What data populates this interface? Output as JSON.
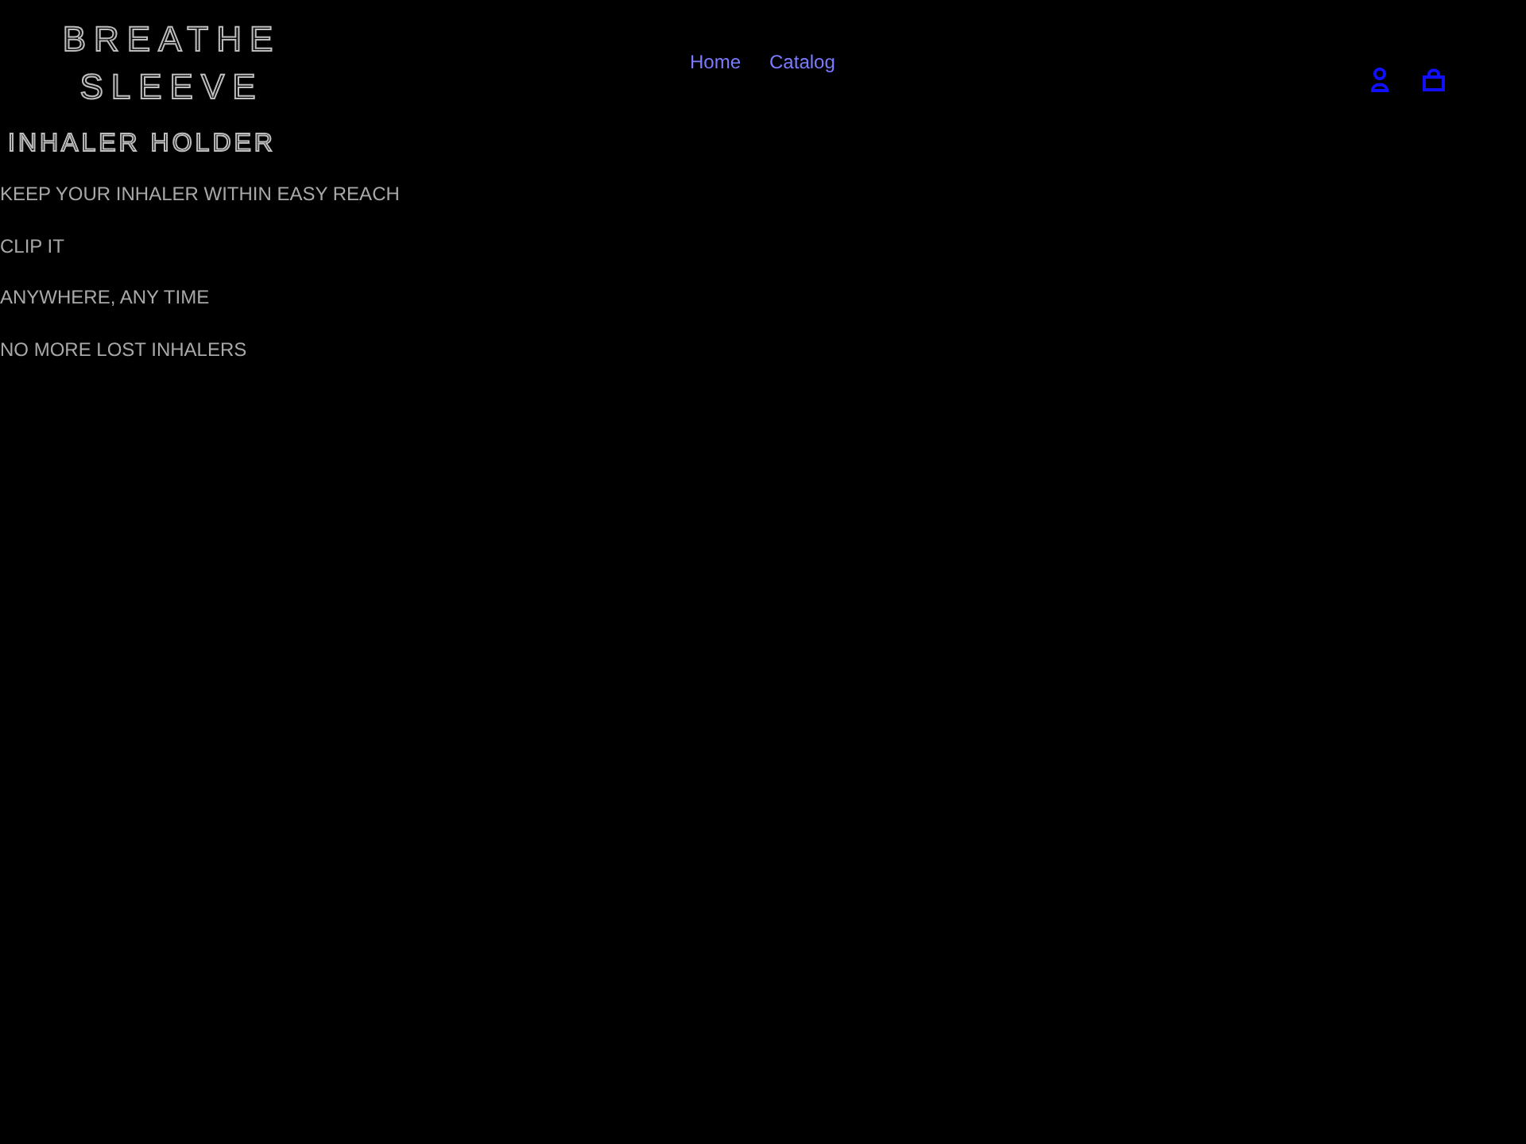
{
  "header": {
    "logo_lines": [
      "BREATHE",
      "SLEEVE"
    ],
    "nav": [
      {
        "label": "Home"
      },
      {
        "label": "Catalog"
      }
    ]
  },
  "hero": {
    "title": "INHALER HOLDER",
    "lines": [
      "KEEP YOUR INHALER WITHIN EASY REACH",
      "CLIP IT",
      "ANYWHERE, ANY TIME",
      "NO MORE LOST INHALERS"
    ]
  }
}
